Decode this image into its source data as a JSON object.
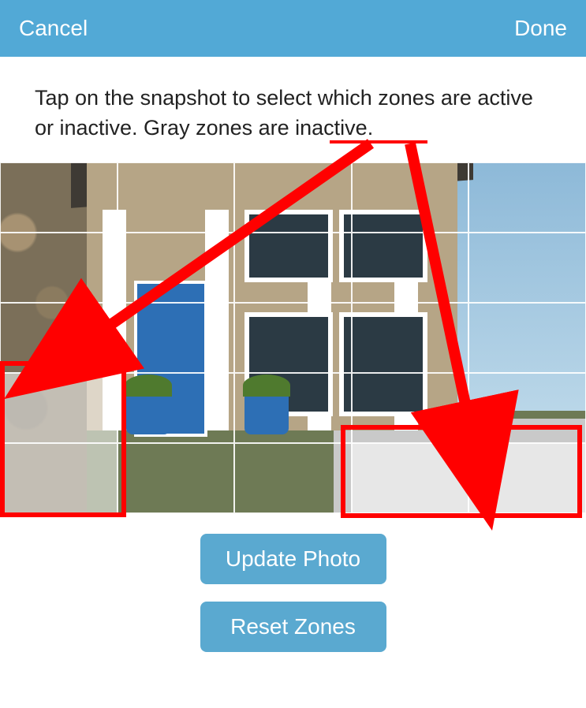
{
  "navbar": {
    "cancel_label": "Cancel",
    "title_label": "",
    "done_label": "Done"
  },
  "instructions_text": "Tap on the snapshot to select which zones are active or inactive. Gray zones are inactive.",
  "grid": {
    "rows": 5,
    "cols": 5,
    "inactive_cells": [
      "r3c0",
      "r4c0",
      "r4c3",
      "r4c4"
    ]
  },
  "buttons": {
    "update_label": "Update Photo",
    "reset_label": "Reset Zones"
  },
  "annotation": {
    "underlined_word": "inactive",
    "box1_target": "bottom-left-inactive-zones",
    "box2_target": "bottom-right-inactive-zones",
    "color": "#ff0000"
  }
}
